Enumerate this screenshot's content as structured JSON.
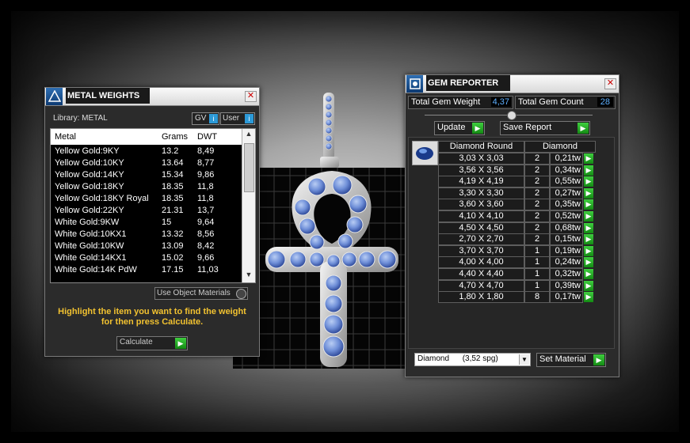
{
  "metal_weights": {
    "title": "METAL WEIGHTS",
    "library_label": "Library: METAL",
    "gv_label": "GV",
    "user_label": "User",
    "columns": [
      "Metal",
      "Grams",
      "DWT"
    ],
    "rows": [
      {
        "metal": "Yellow Gold:9KY",
        "grams": "13.2",
        "dwt": "8,49"
      },
      {
        "metal": "Yellow Gold:10KY",
        "grams": "13.64",
        "dwt": "8,77"
      },
      {
        "metal": "Yellow Gold:14KY",
        "grams": "15.34",
        "dwt": "9,86"
      },
      {
        "metal": "Yellow Gold:18KY",
        "grams": "18.35",
        "dwt": "11,8"
      },
      {
        "metal": "Yellow Gold:18KY Royal",
        "grams": "18.35",
        "dwt": "11,8"
      },
      {
        "metal": "Yellow Gold:22KY",
        "grams": "21.31",
        "dwt": "13,7"
      },
      {
        "metal": "White Gold:9KW",
        "grams": "15",
        "dwt": "9,64"
      },
      {
        "metal": "White Gold:10KX1",
        "grams": "13.32",
        "dwt": "8,56"
      },
      {
        "metal": "White Gold:10KW",
        "grams": "13.09",
        "dwt": "8,42"
      },
      {
        "metal": "White Gold:14KX1",
        "grams": "15.02",
        "dwt": "9,66"
      },
      {
        "metal": "White Gold:14K PdW",
        "grams": "17.15",
        "dwt": "11,03"
      }
    ],
    "use_object_materials": "Use Object Materials",
    "instructions": "Highlight the item you want to find the weight for then press Calculate.",
    "calculate_label": "Calculate"
  },
  "gem_reporter": {
    "title": "GEM REPORTER",
    "total_weight_label": "Total Gem Weight",
    "total_weight_value": "4,37",
    "total_count_label": "Total Gem Count",
    "total_count_value": "28",
    "update_label": "Update",
    "save_report_label": "Save Report",
    "columns": [
      "Diamond Round",
      "Diamond"
    ],
    "rows": [
      {
        "size": "3,03 X 3,03",
        "count": "2",
        "weight": "0,21tw"
      },
      {
        "size": "3,56 X 3,56",
        "count": "2",
        "weight": "0,34tw"
      },
      {
        "size": "4,19 X 4,19",
        "count": "2",
        "weight": "0,55tw"
      },
      {
        "size": "3,30 X 3,30",
        "count": "2",
        "weight": "0,27tw"
      },
      {
        "size": "3,60 X 3,60",
        "count": "2",
        "weight": "0,35tw"
      },
      {
        "size": "4,10 X 4,10",
        "count": "2",
        "weight": "0,52tw"
      },
      {
        "size": "4,50 X 4,50",
        "count": "2",
        "weight": "0,68tw"
      },
      {
        "size": "2,70 X 2,70",
        "count": "2",
        "weight": "0,15tw"
      },
      {
        "size": "3,70 X 3,70",
        "count": "1",
        "weight": "0,19tw"
      },
      {
        "size": "4,00 X 4,00",
        "count": "1",
        "weight": "0,24tw"
      },
      {
        "size": "4,40 X 4,40",
        "count": "1",
        "weight": "0,32tw"
      },
      {
        "size": "4,70 X 4,70",
        "count": "1",
        "weight": "0,39tw"
      },
      {
        "size": "1,80 X 1,80",
        "count": "8",
        "weight": "0,17tw"
      }
    ],
    "material_select": "Diamond      (3,52 spg)",
    "set_material_label": "Set Material"
  },
  "colors": {
    "accent_green": "#2bb02b",
    "gem_blue": "#6f8fd8",
    "instruction_yellow": "#f2c230"
  }
}
